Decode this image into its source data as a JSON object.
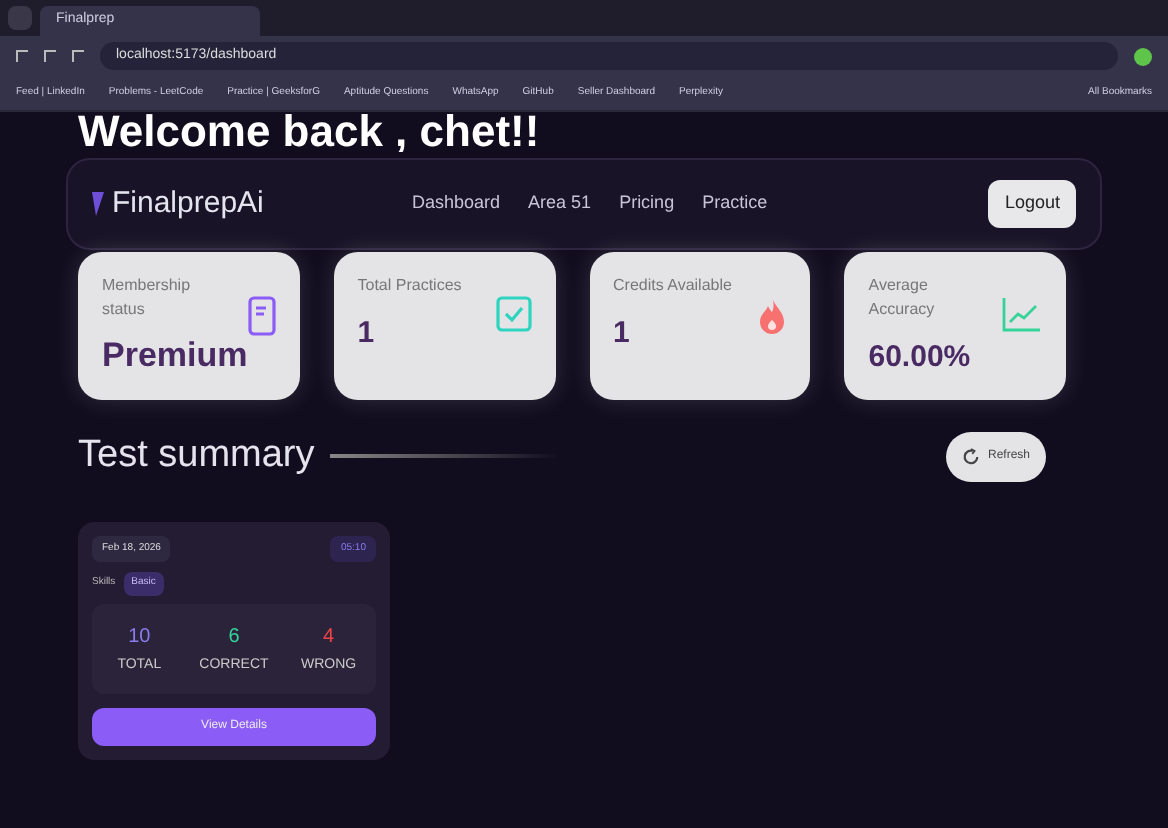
{
  "browser": {
    "tab_title": "Finalprep",
    "url": "localhost:5173/dashboard",
    "bookmarks": [
      "Feed | LinkedIn",
      "Problems - LeetCode",
      "Practice | GeeksforG",
      "Aptitude Questions",
      "WhatsApp",
      "GitHub",
      "Seller Dashboard",
      "Perplexity"
    ],
    "all_bookmarks": "All Bookmarks"
  },
  "welcome": "Welcome back , chet!!",
  "navbar": {
    "logo": "FinalprepAi",
    "links": [
      "Dashboard",
      "Area 51",
      "Pricing",
      "Practice"
    ],
    "logout": "Logout"
  },
  "stats": [
    {
      "label": "Membership status",
      "value": "Premium",
      "kind": "phone",
      "color": "#8b5cf6"
    },
    {
      "label": "Total Practices",
      "value": "1",
      "kind": "check",
      "color": "#2dd4bf"
    },
    {
      "label": "Credits Available",
      "value": "1",
      "kind": "flame",
      "color": "#f87171"
    },
    {
      "label": "Average Accuracy",
      "value": "60.00%",
      "kind": "chart",
      "color": "#34d399"
    }
  ],
  "section": {
    "title": "Test summary",
    "refresh": "Refresh"
  },
  "tests": [
    {
      "date": "Feb 18, 2026",
      "time": "05:10",
      "skills_label": "Skills",
      "skill": "Basic",
      "total": "10",
      "total_label": "TOTAL",
      "correct": "6",
      "correct_label": "CORRECT",
      "wrong": "4",
      "wrong_label": "WRONG",
      "button": "View Details"
    }
  ]
}
